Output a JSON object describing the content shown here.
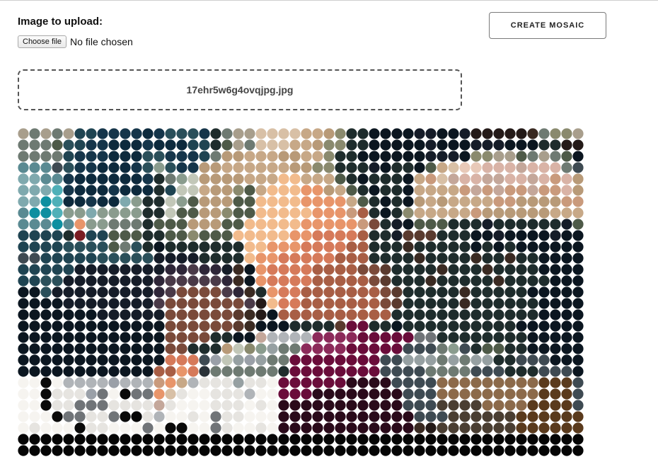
{
  "upload": {
    "label": "Image to upload:",
    "choose_label": "Choose file",
    "status": "No file chosen"
  },
  "actions": {
    "create_label": "CREATE MOSAIC"
  },
  "dropzone": {
    "filename": "17ehr5w6g4ovqjpg.jpg"
  },
  "mosaic": {
    "cols": 50,
    "rows": 29,
    "palette": {
      "A": "#a89e8c",
      "B": "#6e7a72",
      "C": "#1f4452",
      "D": "#15354a",
      "E": "#0d2a3d",
      "F": "#2a4f5a",
      "G": "#5a8a92",
      "H": "#0e8fa0",
      "I": "#4fb0b8",
      "J": "#7fa9ae",
      "K": "#8a9c8e",
      "L": "#c2c7b8",
      "M": "#d8c0a6",
      "N": "#c7a887",
      "O": "#b89a78",
      "P": "#8a8a6e",
      "Q": "#4e5a48",
      "R": "#1e2c2c",
      "S": "#0b1620",
      "T": "#151c28",
      "U": "#e8c9b8",
      "V": "#d9b3a6",
      "W": "#c99a7c",
      "X": "#f2bb8c",
      "Y": "#e8956a",
      "Z": "#d67a5a",
      "a": "#a85e45",
      "b": "#7a4a3a",
      "c": "#5a3a2e",
      "d": "#3a2a22",
      "e": "#241a18",
      "f": "#2e2638",
      "g": "#4a3a48",
      "h": "#7a1c22",
      "i": "#8c2a5a",
      "j": "#6a0c3a",
      "k": "#2a0a1a",
      "l": "#c4a79a",
      "m": "#f6f4f0",
      "n": "#e6e4e0",
      "o": "#b0b4b8",
      "p": "#9aa0a8",
      "q": "#707478",
      "r": "#0a0a0a",
      "s": "#050505",
      "t": "#3e4a52",
      "u": "#8c6a4a",
      "v": "#5a3a1c",
      "w": "#c27a4e",
      "x": "#96a0a2",
      "y": "#4a3e32",
      "z": "#2a3238"
    },
    "rows_data": [
      "ABABACCDDDDEDFFFDRBAAMMMMNNOPRRSSSSTTSSTeeeeedBPPA",
      "BBBQFCDDEEEDEEECCRQABMMMNNOPPRRSSSSSTSSSTTTSSSRRee",
      "BBBBCDDDEEEFFDDDCBOONNNOONNPRRSSSSSSTTTSPPAAQBABQS",
      "GGGtFDDEEEDFKFDDOONNNNNNOOPPRRRTSRRSQNMUUVVVlVVVBt",
      "JJGGDEEEEEEDRBKLOOOONNNXXNNNQRSRRRSNWMlVVllVVlVWVO",
      "JJJIDEEEDEEERCLLNOOPQNXXXYYONQRSRRSNNNNWlWlWWlWWVO",
      "JJHIEEDEEJKRRLKQOOOQQXXXXYYYYNQRSRSONONNNNWWOOOOWW",
      "GHHIKKJKKKKRRLQQOOPQQXXXXXYYYWaRSRPNNNNNWOOOOOONNN",
      "GGGHGYKKBBBRQQQOOOQQXXXXXYYYYYWbRTSQQQRRRTRRRRRRTQ",
      "CCCCRhCCQQQRRQQPQQQXXXXXYYZZZZaRRTcccRRRSSTSSSSTSS",
      "CCCCFFFFQBFRSRRRRRRRXXYYYZZZZaaRRRdRRRRRSRSRSSSSSS",
      "ttCCCCCFFFFFTTTTRRRRXYYZZZZZaaaRRRRdRRRRdRRdRRSSSS",
      "CCCCCTTTTTTTTffgffTdSYZZZZaaaabbcRRRRdRRRdRRRRSSSS",
      "CCFFTTTTTTTTfgggggfdSYZZZZaaaaabcRRRdRRRRRdRRRRSSS",
      "SSFTTTTTTTTTfgbbbbgfdRYZZaaaaaaabcRRRRRdRRRRRSSSSS",
      "SSSSTTTTTTTTgbbbbbbbgeXZZaaaaaaabcRRRRRdRRRRRRSSSS",
      "SSSSSSSTTTTTTbbbbbbcdeSaaaaaaaaaaRRRRRRRRRRRRRSSSS",
      "SSSSSSSSSSSSSbbbbbbcdSSSRRRRcjjRRSRRRRRRRRRRSSSSSS",
      "SSSSSSSSSSSSSbbbbRRSSlooooiiiijjjjjqqRRRRRRRRSSSSS",
      "SSSSSSSSSSSSSbbRRROLPKxBBiiiijjjjjtttBKtRQQRRSSSSS",
      "SSSSSSSSSSSSSZZZtpLxpxBBjjjjjjjjttxxxBxBxxRRtttSSS",
      "SSSSSSSSSSSSaaYZzBBBBBBRjjjjjjjjttttBBBBtttRRRtttS",
      "mmrmoooopoooWYNonnnxnnmjjjjjjkkkkttttuuuuuuuuuvvvt",
      "mmrnnnpqmrqqYMnmmnnnommjjjkkkkkkkktttuuuuuuuuuvvvt",
      "mmrnnqqqnnnnlnmmmnnnmnmkkkkkkkkkkktttyyyyuuuuvvvvt",
      "mmmrqqnnqrsnommnmqnnmmmkkkkkkkkkkkktttyyyyyyvvvvvv",
      "mnmmmrnnmmmqmrrmmqnmmnmkkkkkkkkkkkkdeyyyyyyyvvvvvv",
      "ssssssssssssssssssssssssssssssssssssssssssssssssss",
      "ssssssssssssssssssssssssssssssssssssssssssssssssss"
    ]
  }
}
